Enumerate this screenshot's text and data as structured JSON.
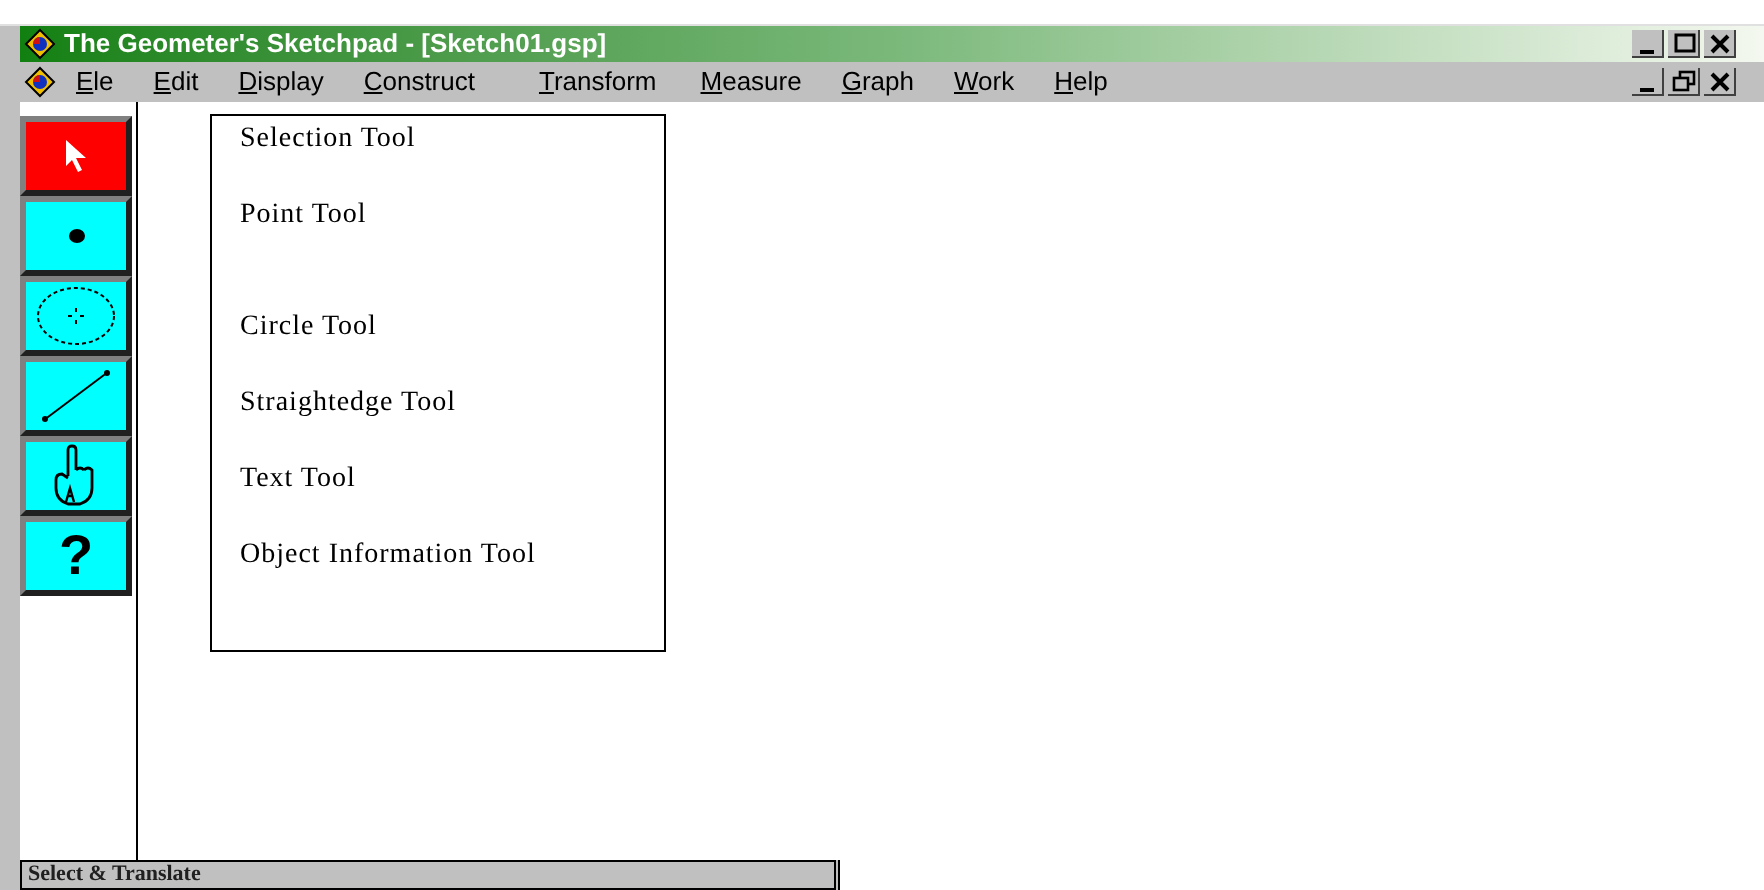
{
  "window": {
    "title": "The Geometer's Sketchpad - [Sketch01.gsp]"
  },
  "menu_bar": [
    {
      "label": "Ele"
    },
    {
      "label": "Edit"
    },
    {
      "label": "Display"
    },
    {
      "label": "Construct"
    },
    {
      "label": "Transform"
    },
    {
      "label": "Measure"
    },
    {
      "label": "Graph"
    },
    {
      "label": "Work"
    },
    {
      "label": "Help"
    }
  ],
  "toolbox": [
    {
      "kind": "arrow",
      "selected": true
    },
    {
      "kind": "point",
      "selected": false
    },
    {
      "kind": "compass",
      "selected": false
    },
    {
      "kind": "straightedge",
      "selected": false
    },
    {
      "kind": "text",
      "selected": false
    },
    {
      "kind": "info",
      "selected": false,
      "glyph": "?"
    }
  ],
  "tool_menu": [
    {
      "label": "Selection Tool"
    },
    {
      "label": "Point Tool",
      "gap_after": true
    },
    {
      "label": "Circle Tool"
    },
    {
      "label": "Straightedge Tool"
    },
    {
      "label": "Text Tool"
    },
    {
      "label": "Object Information Tool"
    }
  ],
  "status_bar": {
    "text": "Select & Translate"
  }
}
